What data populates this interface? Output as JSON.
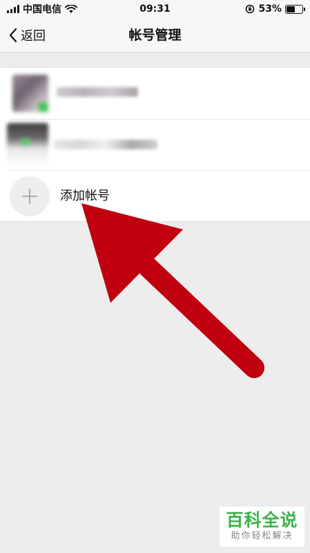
{
  "status_bar": {
    "carrier": "中国电信",
    "time": "09:31",
    "battery": "53%",
    "battery_level": 0.53,
    "icons": [
      "signal-icon",
      "wifi-icon",
      "orientation-lock-icon",
      "battery-icon"
    ]
  },
  "nav": {
    "back_label": "返回",
    "title": "帐号管理"
  },
  "accounts": [
    {
      "name": "",
      "avatar": "blurred-avatar"
    },
    {
      "name": "",
      "avatar": "blurred-avatar"
    }
  ],
  "add_account": {
    "label": "添加帐号",
    "icon": "plus-icon"
  },
  "annotation": {
    "arrow_color": "#c0000f"
  },
  "watermark": {
    "main": "百科全说",
    "sub": "助你轻松解决",
    "color": "#3eb24a"
  }
}
